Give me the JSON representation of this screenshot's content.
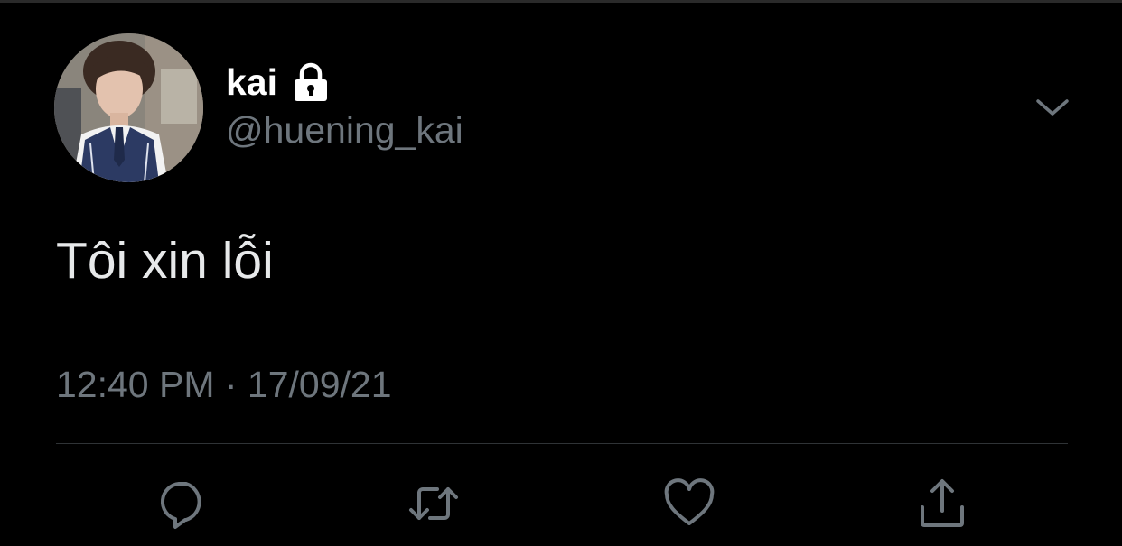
{
  "tweet": {
    "display_name": "kai",
    "handle": "@huening_kai",
    "text": "Tôi xin lỗi",
    "timestamp": "12:40 PM · 17/09/21",
    "protected_icon": "lock-icon",
    "menu_icon": "chevron-down-icon"
  },
  "actions": [
    {
      "name": "reply",
      "icon": "reply-icon"
    },
    {
      "name": "retweet",
      "icon": "retweet-icon"
    },
    {
      "name": "like",
      "icon": "heart-icon"
    },
    {
      "name": "share",
      "icon": "share-icon"
    }
  ],
  "colors": {
    "background": "#000000",
    "primary_text": "#e7e9ea",
    "secondary_text": "#6e767d",
    "divider": "#2f3336"
  }
}
